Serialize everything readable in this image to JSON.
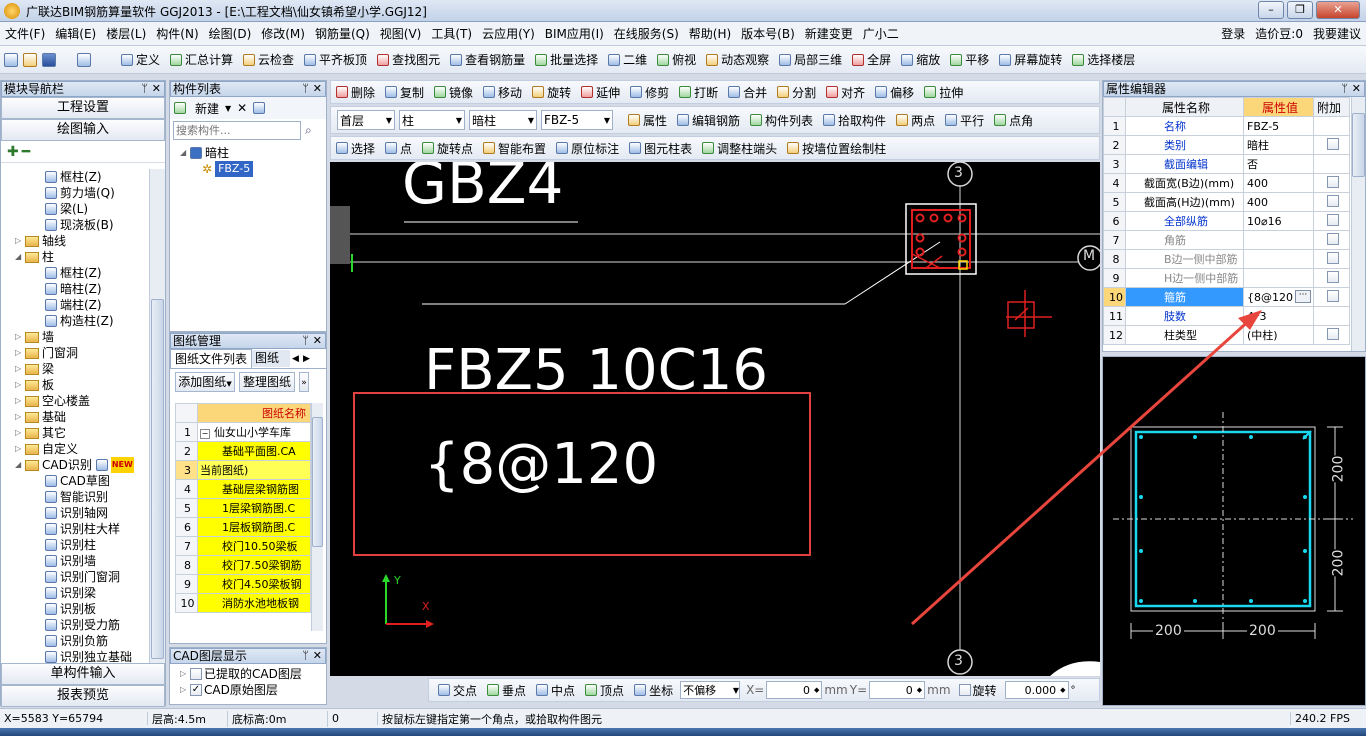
{
  "window": {
    "title": "广联达BIM钢筋算量软件 GGJ2013 - [E:\\工程文档\\仙女镇希望小学.GGJ12]",
    "buttons": [
      "–",
      "❐",
      "✕"
    ]
  },
  "menu": [
    "文件(F)",
    "编辑(E)",
    "楼层(L)",
    "构件(N)",
    "绘图(D)",
    "修改(M)",
    "钢筋量(Q)",
    "视图(V)",
    "工具(T)",
    "云应用(Y)",
    "BIM应用(I)",
    "在线服务(S)",
    "帮助(H)",
    "版本号(B)",
    "新建变更",
    "广小二"
  ],
  "menu_right": [
    "登录",
    "造价豆:0",
    "我要建议"
  ],
  "toolbar1": [
    "定义",
    "汇总计算",
    "云检查",
    "平齐板顶",
    "查找图元",
    "查看钢筋量",
    "批量选择",
    "二维",
    "俯视",
    "动态观察",
    "局部三维",
    "全屏",
    "缩放",
    "平移",
    "屏幕旋转",
    "选择楼层"
  ],
  "toolbar2": [
    "删除",
    "复制",
    "镜像",
    "移动",
    "旋转",
    "延伸",
    "修剪",
    "打断",
    "合并",
    "分割",
    "对齐",
    "偏移",
    "拉伸"
  ],
  "toolbar3": {
    "floor": "首层",
    "category": "柱",
    "type": "暗柱",
    "name": "FBZ-5",
    "buttons": [
      "属性",
      "编辑钢筋",
      "构件列表",
      "拾取构件",
      "两点",
      "平行",
      "点角"
    ]
  },
  "toolbar4": [
    "选择",
    "点",
    "旋转点",
    "智能布置",
    "原位标注",
    "图元柱表",
    "调整柱端头",
    "按墙位置绘制柱"
  ],
  "nav": {
    "title": "模块导航栏",
    "buttons": [
      "工程设置",
      "绘图输入"
    ],
    "tree": [
      {
        "label": "框柱(Z)",
        "level": 3
      },
      {
        "label": "剪力墙(Q)",
        "level": 3
      },
      {
        "label": "梁(L)",
        "level": 3
      },
      {
        "label": "现浇板(B)",
        "level": 3
      },
      {
        "label": "轴线",
        "level": 1,
        "folder": true
      },
      {
        "label": "柱",
        "level": 1,
        "folder": true,
        "open": true
      },
      {
        "label": "框柱(Z)",
        "level": 3
      },
      {
        "label": "暗柱(Z)",
        "level": 3
      },
      {
        "label": "端柱(Z)",
        "level": 3
      },
      {
        "label": "构造柱(Z)",
        "level": 3
      },
      {
        "label": "墙",
        "level": 1,
        "folder": true
      },
      {
        "label": "门窗洞",
        "level": 1,
        "folder": true
      },
      {
        "label": "梁",
        "level": 1,
        "folder": true
      },
      {
        "label": "板",
        "level": 1,
        "folder": true
      },
      {
        "label": "空心楼盖",
        "level": 1,
        "folder": true
      },
      {
        "label": "基础",
        "level": 1,
        "folder": true
      },
      {
        "label": "其它",
        "level": 1,
        "folder": true
      },
      {
        "label": "自定义",
        "level": 1,
        "folder": true
      },
      {
        "label": "CAD识别",
        "level": 1,
        "folder": true,
        "open": true,
        "badge": "NEW"
      },
      {
        "label": "CAD草图",
        "level": 3
      },
      {
        "label": "智能识别",
        "level": 3
      },
      {
        "label": "识别轴网",
        "level": 3
      },
      {
        "label": "识别柱大样",
        "level": 3
      },
      {
        "label": "识别柱",
        "level": 3
      },
      {
        "label": "识别墙",
        "level": 3
      },
      {
        "label": "识别门窗洞",
        "level": 3
      },
      {
        "label": "识别梁",
        "level": 3
      },
      {
        "label": "识别板",
        "level": 3
      },
      {
        "label": "识别受力筋",
        "level": 3
      },
      {
        "label": "识别负筋",
        "level": 3
      },
      {
        "label": "识别独立基础",
        "level": 3
      }
    ],
    "bottom_buttons": [
      "单构件输入",
      "报表预览"
    ]
  },
  "component_list": {
    "title": "构件列表",
    "new_label": "新建",
    "search_placeholder": "搜索构件...",
    "tree_root": "暗柱",
    "tree_child": "FBZ-5"
  },
  "drawing_mgmt": {
    "title": "图纸管理",
    "tabs": [
      "图纸文件列表",
      "图纸楼"
    ],
    "buttons": [
      "添加图纸",
      "整理图纸"
    ],
    "header": "图纸名称",
    "rows": [
      {
        "n": "1",
        "name": "仙女山小学车库"
      },
      {
        "n": "2",
        "name": "基础平面图.CA"
      },
      {
        "n": "3",
        "name": "当前图纸)"
      },
      {
        "n": "4",
        "name": "基础层梁钢筋图"
      },
      {
        "n": "5",
        "name": "1层梁钢筋图.C"
      },
      {
        "n": "6",
        "name": "1层板钢筋图.C"
      },
      {
        "n": "7",
        "name": "校门10.50梁板"
      },
      {
        "n": "8",
        "name": "校门7.50梁钢筋"
      },
      {
        "n": "9",
        "name": "校门4.50梁板钢"
      },
      {
        "n": "10",
        "name": "消防水池地板钢"
      }
    ]
  },
  "cad_layers": {
    "title": "CAD图层显示",
    "items": [
      "已提取的CAD图层",
      "CAD原始图层"
    ]
  },
  "canvas": {
    "text_top": "GBZ4",
    "text_main1": "FBZ5 10C16",
    "text_main2": "{8@120",
    "axis_labels": [
      "3",
      "3",
      "M"
    ],
    "axis_x": "X",
    "axis_y": "Y"
  },
  "snap_bar": {
    "buttons": [
      "交点",
      "垂点",
      "中点",
      "顶点",
      "坐标"
    ],
    "offset_mode": "不偏移",
    "x_label": "X=",
    "x_value": "0",
    "y_label": "Y=",
    "y_value": "0",
    "unit": "mm",
    "rotate_label": "旋转",
    "rotate_value": "0.000"
  },
  "property_editor": {
    "title": "属性编辑器",
    "headers": [
      "属性名称",
      "属性值",
      "附加"
    ],
    "rows": [
      {
        "n": "1",
        "name": "名称",
        "value": "FBZ-5",
        "blue": true,
        "check": false
      },
      {
        "n": "2",
        "name": "类别",
        "value": "暗柱",
        "blue": true,
        "check": true
      },
      {
        "n": "3",
        "name": "截面编辑",
        "value": "否",
        "blue": true,
        "check": false
      },
      {
        "n": "4",
        "name": "截面宽(B边)(mm)",
        "value": "400",
        "blue": false,
        "check": true
      },
      {
        "n": "5",
        "name": "截面高(H边)(mm)",
        "value": "400",
        "blue": false,
        "check": true
      },
      {
        "n": "6",
        "name": "全部纵筋",
        "value": "10⌀16",
        "blue": true,
        "check": true
      },
      {
        "n": "7",
        "name": "角筋",
        "value": "",
        "gray": true,
        "check": true
      },
      {
        "n": "8",
        "name": "B边一侧中部筋",
        "value": "",
        "gray": true,
        "check": true
      },
      {
        "n": "9",
        "name": "H边一侧中部筋",
        "value": "",
        "gray": true,
        "check": true
      },
      {
        "n": "10",
        "name": "箍筋",
        "value": "{8@120",
        "blue": true,
        "check": true,
        "selected": true
      },
      {
        "n": "11",
        "name": "肢数",
        "value": "4*3",
        "blue": true,
        "check": false
      },
      {
        "n": "12",
        "name": "柱类型",
        "value": "(中柱)",
        "blue": false,
        "check": true
      }
    ]
  },
  "section_preview": {
    "dims": [
      "200",
      "200",
      "200",
      "200"
    ]
  },
  "status": {
    "coords": "X=5583 Y=65794",
    "floor_height": "层高:4.5m",
    "bottom_elev": "底标高:0m",
    "count": "0",
    "hint": "按鼠标左键指定第一个角点，或拾取构件图元",
    "fps": "240.2 FPS"
  }
}
